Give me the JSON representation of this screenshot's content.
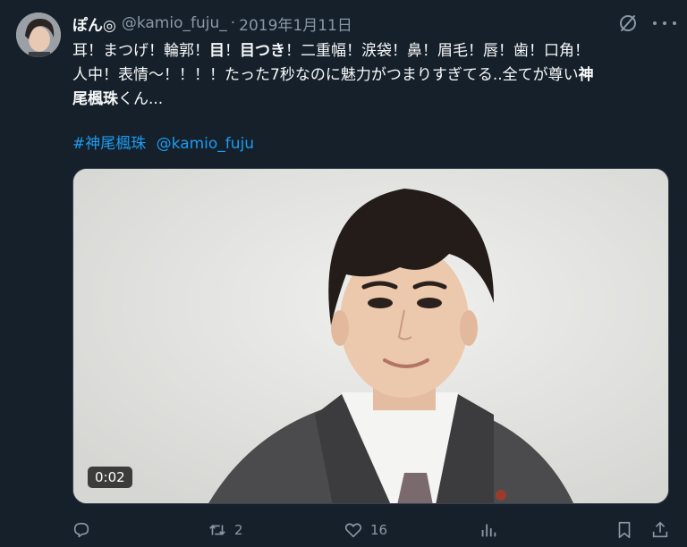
{
  "tweet": {
    "display_name": "ぽん◎",
    "handle": "@kamio_fuju_",
    "separator": "·",
    "date": "2019年1月11日",
    "text_lines": [
      {
        "pre": "耳！まつげ！輪郭！",
        "bold1": "目",
        "mid": "！",
        "bold2": "目つき",
        "post": "！二重幅！涙袋！鼻！眉毛！唇！歯！口角！"
      },
      {
        "pre": "人中！表情〜！！！！たった7秒なのに魅力がつまりすぎてる..全てが尊い",
        "bold1": "神",
        "mid": "",
        "bold2": "",
        "post": ""
      },
      {
        "pre": "",
        "bold1": "尾楓珠",
        "mid": "くん...",
        "bold2": "",
        "post": ""
      }
    ],
    "hashtag": "#神尾楓珠",
    "mention": "@kamio_fuju"
  },
  "media": {
    "type": "video",
    "time": "0:02",
    "description_icon": "video-thumbnail"
  },
  "actions": {
    "reply_count": "",
    "retweet_count": "2",
    "like_count": "16",
    "views_count": ""
  },
  "colors": {
    "background": "#15202b",
    "text": "#f7f9f9",
    "secondary": "#8b98a5",
    "accent": "#1d9bf0"
  }
}
